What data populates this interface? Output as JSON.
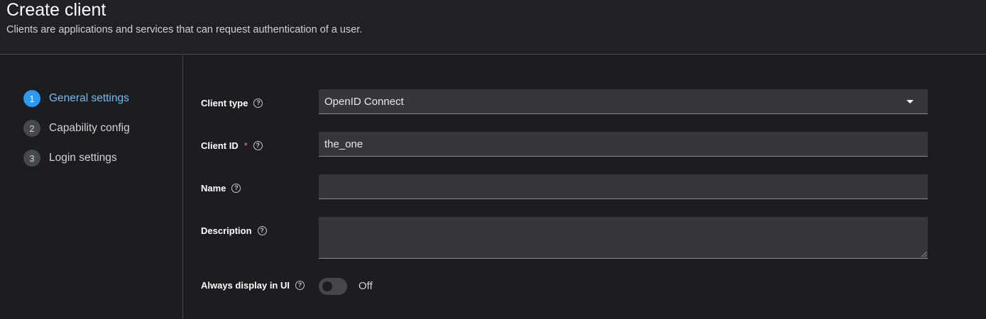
{
  "header": {
    "title": "Create client",
    "subtitle": "Clients are applications and services that can request authentication of a user."
  },
  "wizard": {
    "steps": [
      {
        "number": "1",
        "label": "General settings",
        "current": true
      },
      {
        "number": "2",
        "label": "Capability config",
        "current": false
      },
      {
        "number": "3",
        "label": "Login settings",
        "current": false
      }
    ]
  },
  "form": {
    "client_type": {
      "label": "Client type",
      "value": "OpenID Connect"
    },
    "client_id": {
      "label": "Client ID",
      "required_mark": "*",
      "value": "the_one"
    },
    "name": {
      "label": "Name",
      "value": ""
    },
    "description": {
      "label": "Description",
      "value": ""
    },
    "always_display": {
      "label": "Always display in UI",
      "state": "Off",
      "on": false
    }
  },
  "icons": {
    "help": "?"
  },
  "colors": {
    "background": "#1b1d21",
    "accent": "#2b9af3",
    "accent_text": "#73bcf7",
    "required": "#f0857a",
    "field_bg": "#36373b"
  }
}
